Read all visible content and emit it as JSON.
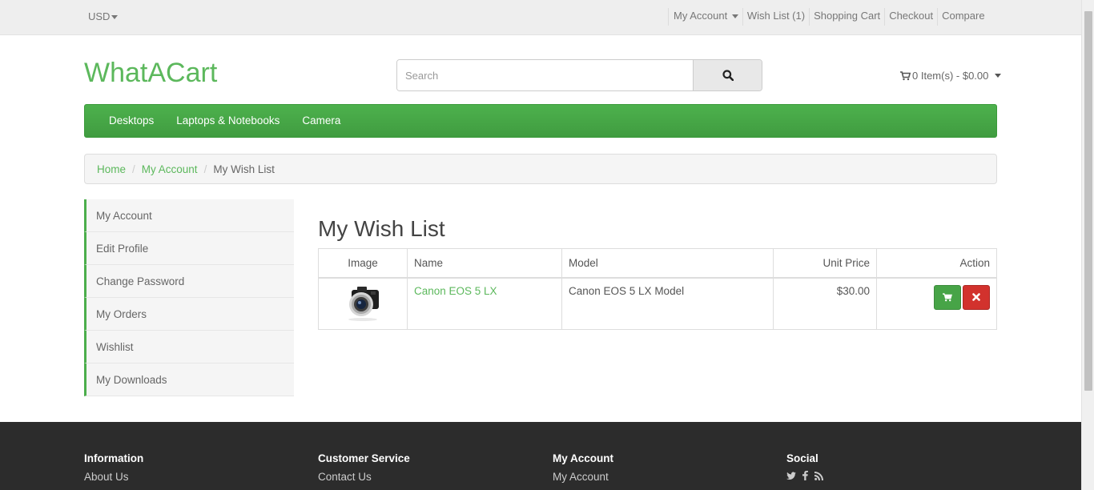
{
  "topbar": {
    "currency": "USD",
    "links": {
      "my_account": "My Account",
      "wish_list": "Wish List (1)",
      "shopping_cart": "Shopping Cart",
      "checkout": "Checkout",
      "compare": "Compare"
    }
  },
  "header": {
    "logo": "WhatACart",
    "search_placeholder": "Search",
    "cart_summary": "0 Item(s) - $0.00"
  },
  "nav": {
    "items": [
      "Desktops",
      "Laptops & Notebooks",
      "Camera"
    ]
  },
  "breadcrumb": {
    "home": "Home",
    "account": "My Account",
    "current": "My Wish List"
  },
  "sidebar": {
    "items": [
      "My Account",
      "Edit Profile",
      "Change Password",
      "My Orders",
      "Wishlist",
      "My Downloads"
    ]
  },
  "main": {
    "title": "My Wish List",
    "columns": [
      "Image",
      "Name",
      "Model",
      "Unit Price",
      "Action"
    ],
    "rows": [
      {
        "name": "Canon EOS 5 LX",
        "model": "Canon EOS 5 LX Model",
        "price": "$30.00"
      }
    ]
  },
  "footer": {
    "columns": [
      {
        "heading": "Information",
        "link": "About Us"
      },
      {
        "heading": "Customer Service",
        "link": "Contact Us"
      },
      {
        "heading": "My Account",
        "link": "My Account"
      },
      {
        "heading": "Social"
      }
    ]
  },
  "colors": {
    "brand_green": "#5cb85c",
    "danger_red": "#d2322d",
    "footer_bg": "#2c2c2c"
  }
}
